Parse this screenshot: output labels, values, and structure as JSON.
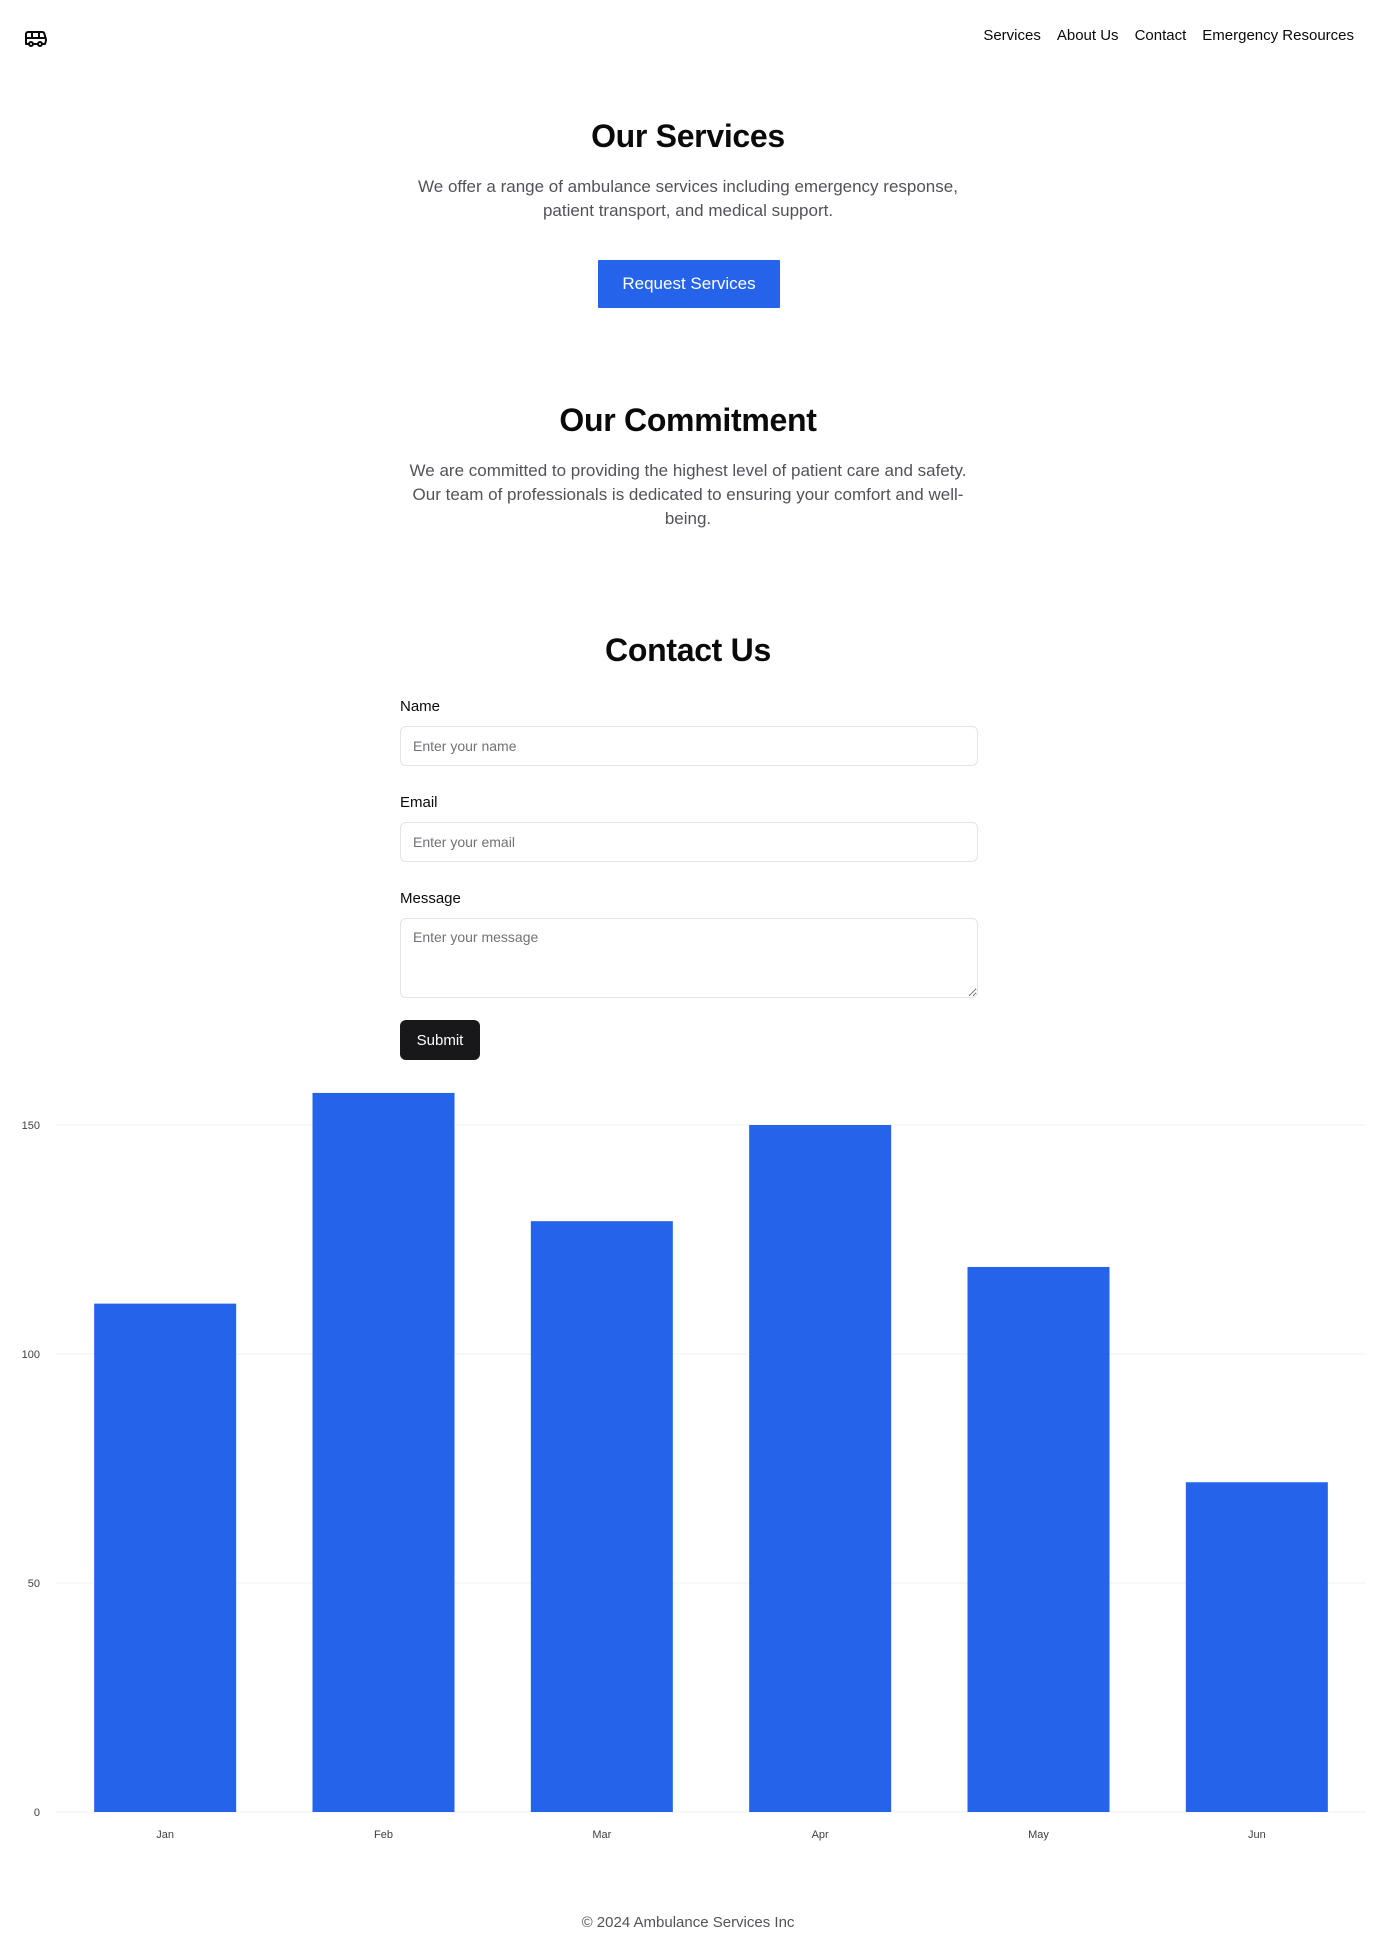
{
  "header": {
    "logo_icon": "ambulance-bus-icon",
    "nav": [
      {
        "label": "Services"
      },
      {
        "label": "About Us"
      },
      {
        "label": "Contact"
      },
      {
        "label": "Emergency Resources"
      }
    ]
  },
  "services": {
    "title": "Our Services",
    "description": "We offer a range of ambulance services including emergency response, patient transport, and medical support.",
    "button_label": "Request Services"
  },
  "commitment": {
    "title": "Our Commitment",
    "description": "We are committed to providing the highest level of patient care and safety. Our team of professionals is dedicated to ensuring your comfort and well-being."
  },
  "contact": {
    "title": "Contact Us",
    "name_label": "Name",
    "name_placeholder": "Enter your name",
    "email_label": "Email",
    "email_placeholder": "Enter your email",
    "message_label": "Message",
    "message_placeholder": "Enter your message",
    "submit_label": "Submit"
  },
  "chart_data": {
    "type": "bar",
    "categories": [
      "Jan",
      "Feb",
      "Mar",
      "Apr",
      "May",
      "Jun"
    ],
    "values": [
      111,
      157,
      129,
      150,
      119,
      72
    ],
    "yticks": [
      0,
      50,
      100,
      150
    ],
    "ylim": [
      0,
      160
    ],
    "grid": true,
    "bar_color": "#2563eb"
  },
  "footer": {
    "text": "© 2024 Ambulance Services Inc"
  },
  "colors": {
    "accent": "#2563eb",
    "dark_button": "#18181b",
    "muted_text": "#52525b"
  }
}
